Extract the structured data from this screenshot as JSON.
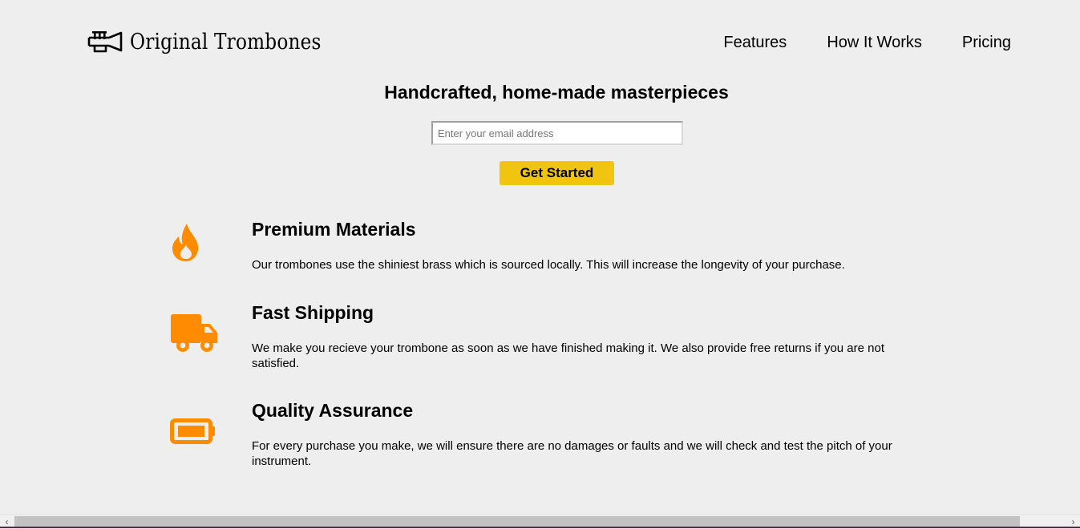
{
  "header": {
    "logo_text": "Original Trombones",
    "logo_icon": "trumpet-icon",
    "nav": [
      {
        "label": "Features"
      },
      {
        "label": "How It Works"
      },
      {
        "label": "Pricing"
      }
    ]
  },
  "hero": {
    "title": "Handcrafted, home-made masterpieces",
    "email_placeholder": "Enter your email address",
    "email_value": "",
    "cta_label": "Get Started"
  },
  "features": [
    {
      "icon": "fire-icon",
      "title": "Premium Materials",
      "description": "Our trombones use the shiniest brass which is sourced locally. This will increase the longevity of your purchase."
    },
    {
      "icon": "truck-icon",
      "title": "Fast Shipping",
      "description": "We make you recieve your trombone as soon as we have finished making it. We also provide free returns if you are not satisfied."
    },
    {
      "icon": "battery-icon",
      "title": "Quality Assurance",
      "description": "For every purchase you make, we will ensure there are no damages or faults and we will check and test the pitch of your instrument."
    }
  ],
  "colors": {
    "background": "#eeeeee",
    "accent_button": "#f1c40f",
    "icon_orange": "#ff8c00",
    "text": "#000000"
  },
  "scrollbar": {
    "left_arrow": "‹",
    "right_arrow": "›"
  }
}
